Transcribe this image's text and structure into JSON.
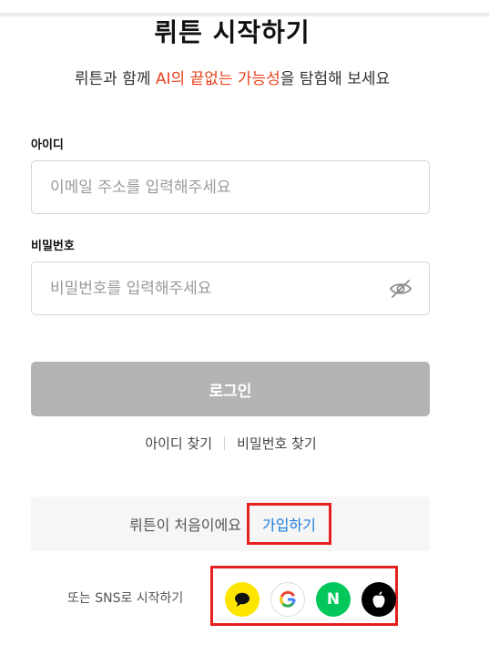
{
  "header": {
    "title": "뤼튼 시작하기",
    "subtitle_before": "뤼튼과 함께 ",
    "subtitle_highlight": "AI의 끝없는 가능성",
    "subtitle_after": "을 탐험해 보세요",
    "highlight_color": "#e8421d"
  },
  "form": {
    "id_label": "아이디",
    "id_placeholder": "이메일 주소를 입력해주세요",
    "password_label": "비밀번호",
    "password_placeholder": "비밀번호를 입력해주세요",
    "login_label": "로그인"
  },
  "links": {
    "find_id": "아이디 찾기",
    "find_password": "비밀번호 찾기"
  },
  "signup": {
    "prompt": "뤼튼이 처음이에요",
    "link_label": "가입하기",
    "link_color": "#1b7de0"
  },
  "sns": {
    "label": "또는 SNS로 시작하기",
    "providers": [
      {
        "name": "kakao",
        "icon": "speech-bubble-icon",
        "color": "#fee500"
      },
      {
        "name": "google",
        "icon": "google-g-icon",
        "color": "#ffffff"
      },
      {
        "name": "naver",
        "icon": "naver-n-icon",
        "glyph": "N",
        "color": "#03c75a"
      },
      {
        "name": "apple",
        "icon": "apple-icon",
        "color": "#000000"
      }
    ]
  },
  "annotation_color": "#e62020"
}
